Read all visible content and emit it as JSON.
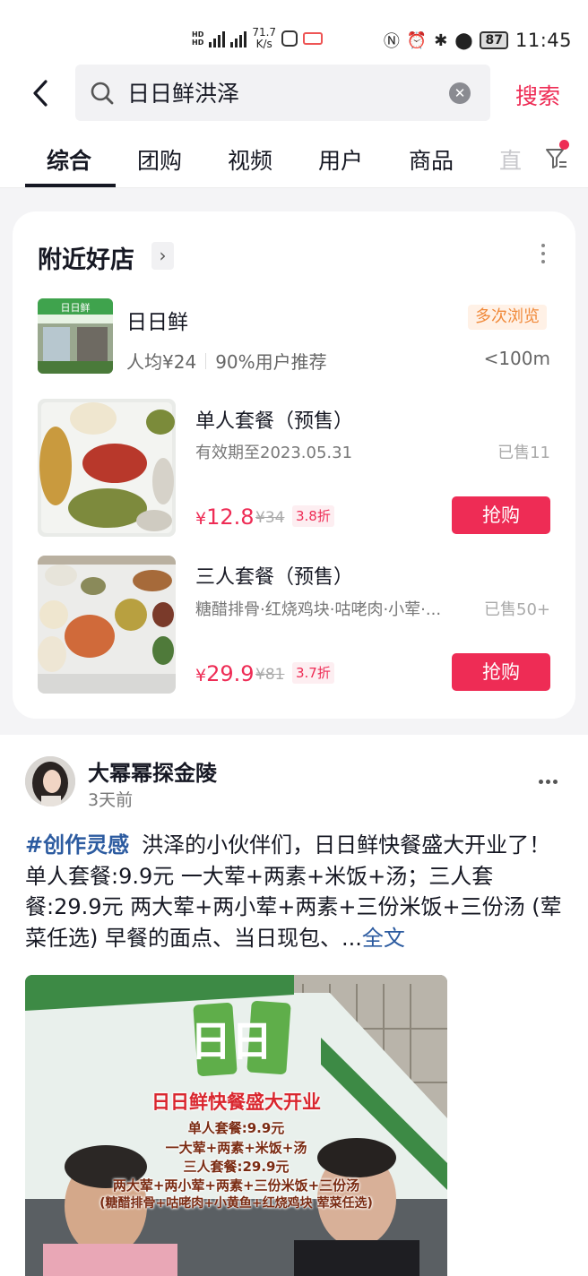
{
  "status_bar": {
    "network_speed": "71.7",
    "network_unit": "K/s",
    "battery": "87",
    "time": "11:45"
  },
  "search": {
    "query": "日日鲜洪泽",
    "submit_label": "搜索"
  },
  "tabs": [
    "综合",
    "团购",
    "视频",
    "用户",
    "商品",
    "直"
  ],
  "nearby_card": {
    "title": "附近好店",
    "shop": {
      "name": "日日鲜",
      "tag": "多次浏览",
      "avg_price": "人均¥24",
      "recommend": "90%用户推荐",
      "distance": "<100m"
    },
    "deals": [
      {
        "name": "单人套餐（预售）",
        "desc": "有效期至2023.05.31",
        "sold": "已售11",
        "price_symbol": "¥",
        "price": "12.8",
        "original_price": "¥34",
        "discount": "3.8折",
        "buy_label": "抢购"
      },
      {
        "name": "三人套餐（预售）",
        "desc": "糖醋排骨·红烧鸡块·咕咾肉·小荤·...",
        "sold": "已售50+",
        "price_symbol": "¥",
        "price": "29.9",
        "original_price": "¥81",
        "discount": "3.7折",
        "buy_label": "抢购"
      }
    ]
  },
  "post": {
    "author": "大幂幂探金陵",
    "time": "3天前",
    "hashtag": "#创作灵感",
    "text": "洪泽的小伙伴们，日日鲜快餐盛大开业了！单人套餐:9.9元 一大荤+两素+米饭+汤；三人套餐:29.9元 两大荤+两小荤+两素+三份米饭+三份汤 (荤菜任选) 早餐的面点、当日现包、...",
    "more_label": "全文",
    "video": {
      "sign_text": "日日",
      "caption_title": "日日鲜快餐盛大开业",
      "caption_lines": [
        "单人套餐:9.9元",
        "一大荤+两素+米饭+汤",
        "三人套餐:29.9元",
        "两大荤+两小荤+两素+三份米饭+三份汤",
        "(糖醋排骨+咕咾肉+小黄鱼+红烧鸡块 荤菜任选)"
      ]
    }
  },
  "colors": {
    "accent": "#ee2c55",
    "link": "#2c5ba0",
    "tag_orange": "#f08a3b"
  }
}
